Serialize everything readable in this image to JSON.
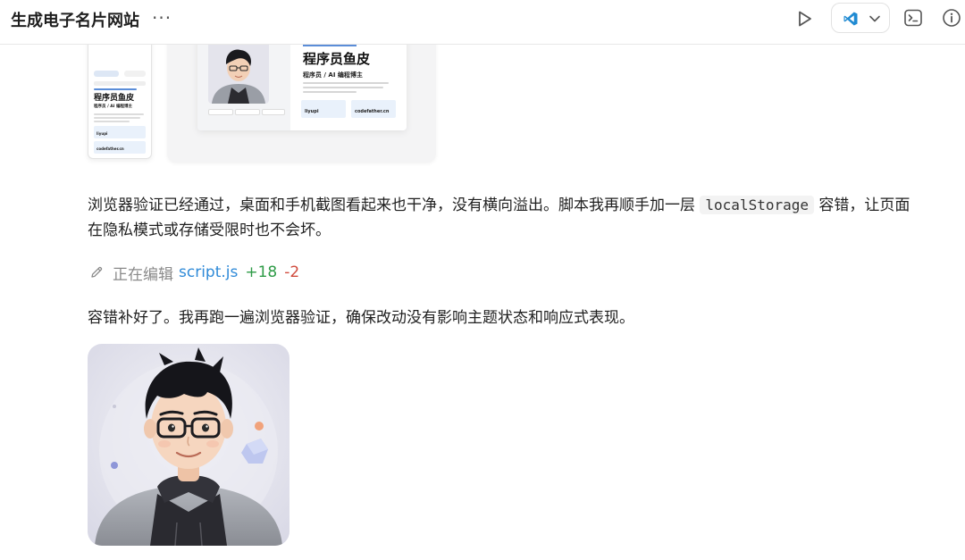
{
  "header": {
    "title": "生成电子名片网站",
    "more_label": "···",
    "run_icon": "play-icon",
    "ide_icon": "vscode-icon",
    "terminal_icon": "terminal-icon",
    "info_icon": "info-icon"
  },
  "preview": {
    "name": "程序员鱼皮",
    "role": "程序员 / AI 编程博主",
    "wechat_label": "WeChat",
    "wechat_value": "liyupi",
    "website_label": "Website",
    "website_value": "codefather.cn"
  },
  "messages": {
    "p1_before": "浏览器验证已经通过，桌面和手机截图看起来也干净，没有横向溢出。脚本我再顺手加一层 ",
    "p1_code": "localStorage",
    "p1_after": " 容错，让页面在隐私模式或存储受限时也不会坏。",
    "edit_status": "正在编辑",
    "edit_file": "script.js",
    "edit_added": "+18",
    "edit_removed": "-2",
    "p2": "容错补好了。我再跑一遍浏览器验证，确保改动没有影响主题状态和响应式表现。"
  },
  "colors": {
    "link": "#2f8ad8",
    "added": "#2e9b47",
    "removed": "#d04a3c",
    "muted": "#8a8a8a"
  }
}
